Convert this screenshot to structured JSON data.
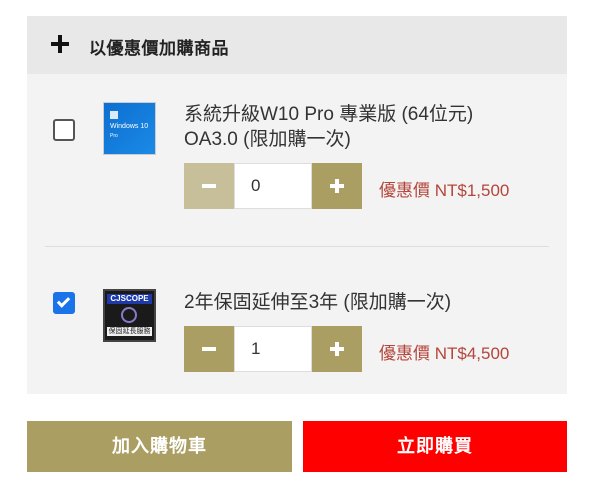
{
  "addon": {
    "header_title": "以優惠價加購商品",
    "items": [
      {
        "title_line1": "系統升級W10 Pro 專業版 (64位元)",
        "title_line2": "OA3.0 (限加購一次)",
        "checked": false,
        "quantity": "0",
        "price": "優惠價 NT$1,500",
        "image_text": "Windows 10",
        "image_subtext": "Pro"
      },
      {
        "title_line1": "2年保固延伸至3年 (限加購一次)",
        "checked": true,
        "quantity": "1",
        "price": "優惠價 NT$4,500",
        "image_top": "CJSCOPE",
        "image_bottom": "保固延長服務"
      }
    ]
  },
  "actions": {
    "add_to_cart": "加入購物車",
    "buy_now": "立即購買"
  },
  "colors": {
    "accent_gold": "#ab9e62",
    "accent_gold_disabled": "#c6bf99",
    "buy_red": "#ff0000",
    "price_red": "#b5453b",
    "checkbox_blue": "#1a73e8"
  },
  "icons": {
    "header": "plus-icon",
    "decrement": "minus-icon",
    "increment": "plus-icon"
  }
}
